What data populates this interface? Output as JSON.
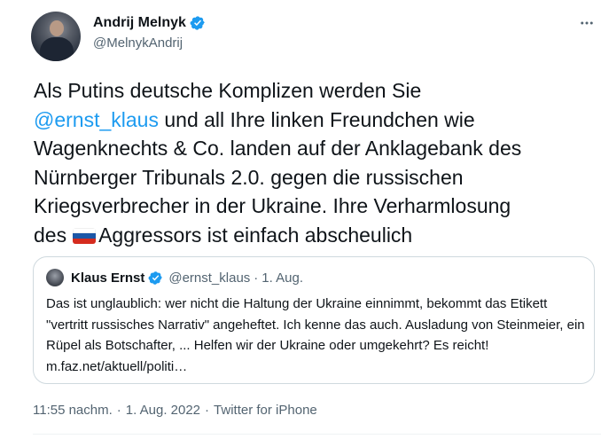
{
  "author": {
    "display_name": "Andrij Melnyk",
    "handle": "@MelnykAndrij",
    "verified": true
  },
  "tweet": {
    "text_before_mention": "Als Putins deutsche Komplizen werden Sie\n",
    "mention": "@ernst_klaus",
    "text_after_mention": " und all Ihre linken Freundchen wie\nWagenknechts & Co. landen auf der Anklagebank des\nNürnberger Tribunals 2.0. gegen die russischen\nKriegsverbrecher in der Ukraine. Ihre Verharmlosung\ndes",
    "flag_icon": "russia-flag",
    "text_after_flag": "Aggressors ist einfach abscheulich"
  },
  "quoted_tweet": {
    "display_name": "Klaus Ernst",
    "verified": true,
    "handle": "@ernst_klaus",
    "separator": "·",
    "date": "1. Aug.",
    "text": "Das ist unglaublich: wer nicht die Haltung der Ukraine einnimmt, bekommt das Etikett \"vertritt russisches Narrativ\" angeheftet. Ich kenne das auch. Ausladung von Steinmeier, ein Rüpel als Botschafter, ... Helfen wir der Ukraine oder umgekehrt? Es reicht! m.faz.net/aktuell/politi…"
  },
  "meta": {
    "time": "11:55 nachm.",
    "separator": "·",
    "date": "1. Aug. 2022",
    "source": "Twitter for iPhone"
  },
  "icons": {
    "verified": "verified-badge-icon",
    "more": "more-options-icon"
  },
  "colors": {
    "link": "#1d9bf0",
    "secondary_text": "#536471",
    "border": "#cfd9de",
    "flag_white": "#ffffff",
    "flag_blue": "#1c57a7",
    "flag_red": "#d52b1e"
  }
}
